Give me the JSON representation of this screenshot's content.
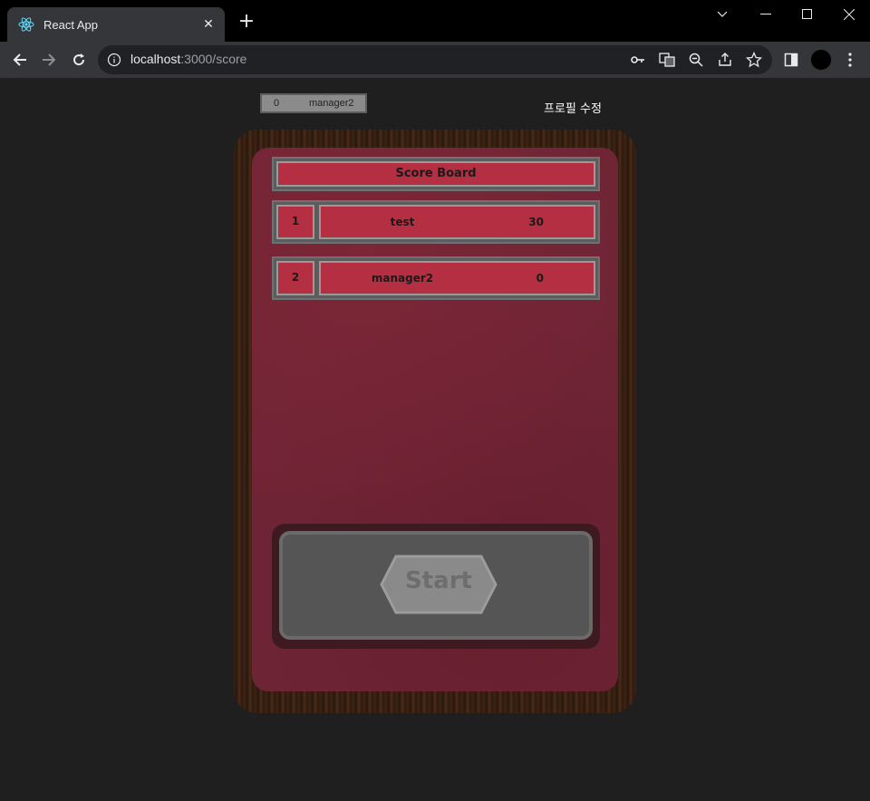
{
  "browser": {
    "tab_title": "React App",
    "url_host": "localhost",
    "url_path": ":3000/score"
  },
  "header": {
    "user_score": "0",
    "user_name": "manager2",
    "profile_edit_label": "프로필 수정"
  },
  "scoreboard": {
    "title": "Score Board",
    "rows": [
      {
        "rank": "1",
        "name": "test",
        "score": "30"
      },
      {
        "rank": "2",
        "name": "manager2",
        "score": "0"
      }
    ]
  },
  "start_label": "Start",
  "colors": {
    "felt": "#6e2535",
    "panel_red": "#b52f43",
    "page_bg": "#1f1f1f"
  }
}
